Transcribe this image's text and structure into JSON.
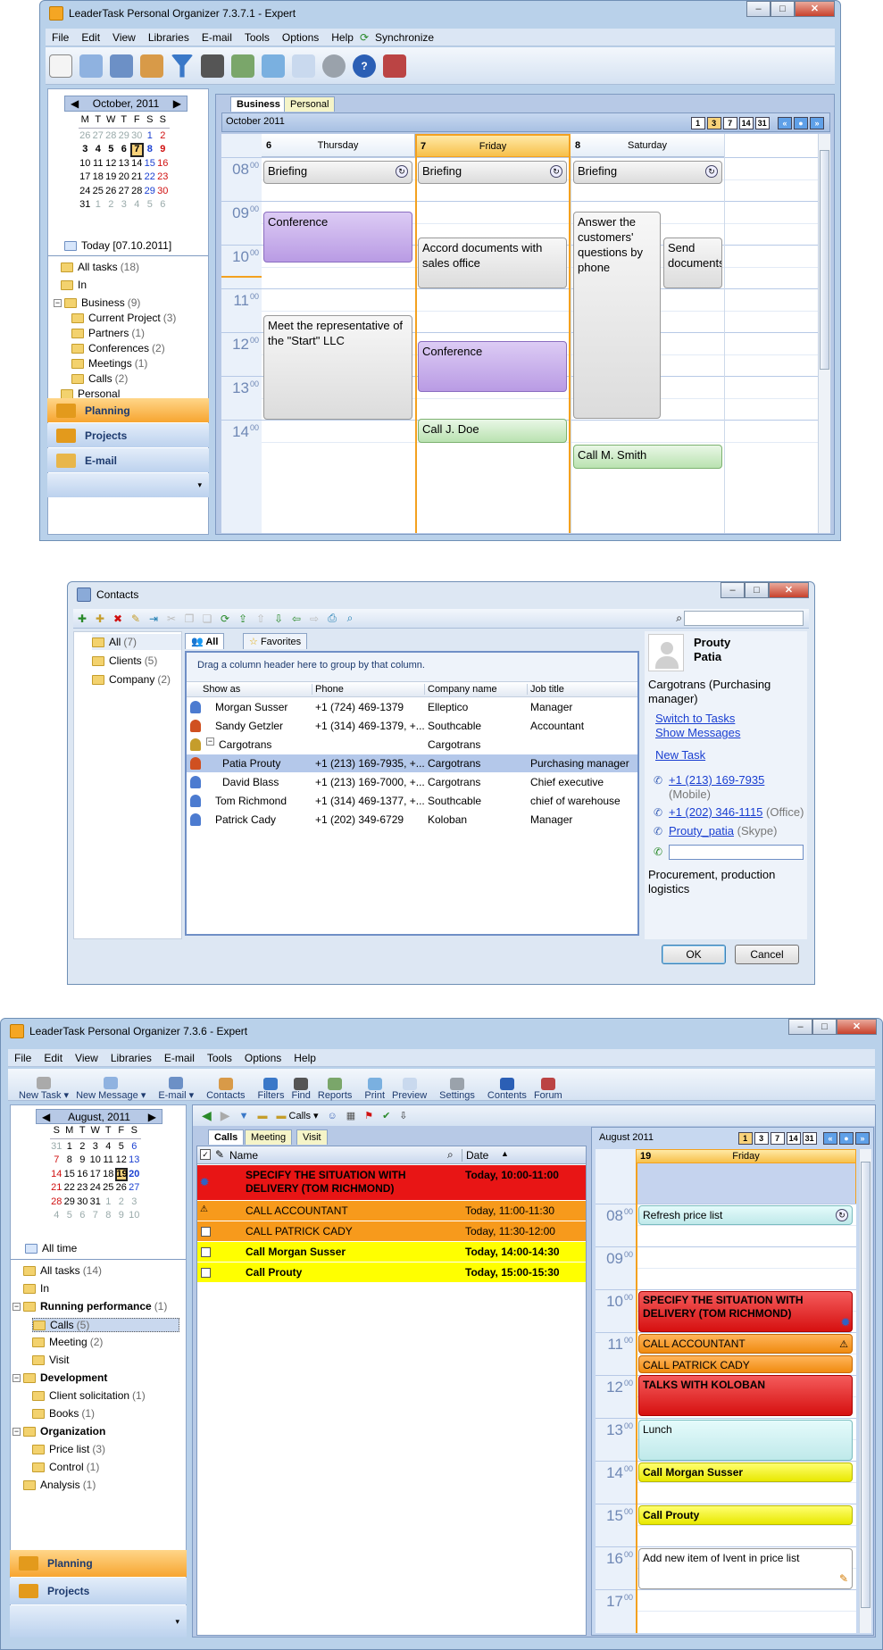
{
  "win1": {
    "title": "LeaderTask Personal Organizer 7.3.7.1 - Expert",
    "menu": [
      "File",
      "Edit",
      "View",
      "Libraries",
      "E-mail",
      "Tools",
      "Options",
      "Help",
      "Synchronize"
    ],
    "mini_cal": {
      "month": "October, 2011",
      "weekdays": [
        "M",
        "T",
        "W",
        "T",
        "F",
        "S",
        "S"
      ],
      "weeks": [
        [
          "26",
          "27",
          "28",
          "29",
          "30",
          "1",
          "2"
        ],
        [
          "3",
          "4",
          "5",
          "6",
          "7",
          "8",
          "9"
        ],
        [
          "10",
          "11",
          "12",
          "13",
          "14",
          "15",
          "16"
        ],
        [
          "17",
          "18",
          "19",
          "20",
          "21",
          "22",
          "23"
        ],
        [
          "24",
          "25",
          "26",
          "27",
          "28",
          "29",
          "30"
        ],
        [
          "31",
          "1",
          "2",
          "3",
          "4",
          "5",
          "6"
        ]
      ],
      "today": "Today [07.10.2011]"
    },
    "tree": [
      {
        "label": "All tasks",
        "count": "(18)"
      },
      {
        "label": "In",
        "count": ""
      },
      {
        "label": "Business",
        "count": "(9)"
      },
      {
        "label": "Current Project",
        "count": "(3)"
      },
      {
        "label": "Partners",
        "count": "(1)"
      },
      {
        "label": "Conferences",
        "count": "(2)"
      },
      {
        "label": "Meetings",
        "count": "(1)"
      },
      {
        "label": "Calls",
        "count": "(2)"
      },
      {
        "label": "Personal",
        "count": ""
      }
    ],
    "nav": [
      "Planning",
      "Projects",
      "E-mail"
    ],
    "tabs": [
      "Business",
      "Personal"
    ],
    "period": "October 2011",
    "views": [
      "1",
      "3",
      "7",
      "14",
      "31"
    ],
    "days": [
      {
        "num": "6",
        "name": "Thursday"
      },
      {
        "num": "7",
        "name": "Friday"
      },
      {
        "num": "8",
        "name": "Saturday"
      }
    ],
    "hours": [
      "08",
      "09",
      "10",
      "11",
      "12",
      "13",
      "14"
    ],
    "minutes": "00",
    "events": {
      "briefing": "Briefing",
      "conference": "Conference",
      "meet": "Meet the representative of the \"Start\" LLC",
      "accord": "Accord documents with sales office",
      "conference2": "Conference",
      "call_doe": "Call J. Doe",
      "answer": "Answer the customers' questions by phone",
      "send": "Send documents",
      "call_smith": "Call M. Smith"
    }
  },
  "win2": {
    "title": "Contacts",
    "groups": [
      {
        "label": "All",
        "count": "(7)"
      },
      {
        "label": "Clients",
        "count": "(5)"
      },
      {
        "label": "Company",
        "count": "(2)"
      }
    ],
    "tabs": [
      "All",
      "Favorites"
    ],
    "group_hint": "Drag a column header here to group by that column.",
    "columns": [
      "Show as",
      "Phone",
      "Company name",
      "Job title"
    ],
    "rows": [
      {
        "name": "Morgan Susser",
        "phone": "+1 (724) 469-1379",
        "company": "Elleptico",
        "job": "Manager"
      },
      {
        "name": "Sandy Getzler",
        "phone": "+1 (314) 469-1379, +...",
        "company": "Southcable",
        "job": "Accountant"
      },
      {
        "name": "Cargotrans",
        "phone": "",
        "company": "Cargotrans",
        "job": ""
      },
      {
        "name": "Patia Prouty",
        "phone": "+1 (213) 169-7935, +...",
        "company": "Cargotrans",
        "job": "Purchasing manager"
      },
      {
        "name": "David Blass",
        "phone": "+1 (213) 169-7000, +...",
        "company": "Cargotrans",
        "job": "Chief executive"
      },
      {
        "name": "Tom Richmond",
        "phone": "+1 (314) 469-1377, +...",
        "company": "Southcable",
        "job": "chief of warehouse"
      },
      {
        "name": "Patrick Cady",
        "phone": "+1 (202) 349-6729",
        "company": "Koloban",
        "job": "Manager"
      }
    ],
    "detail": {
      "last": "Prouty",
      "first": "Patia",
      "company": "Cargotrans (Purchasing manager)",
      "switch": "Switch to Tasks",
      "show": "Show Messages",
      "new_task": "New Task",
      "phone1": "+1 (213) 169-7935",
      "phone1_type": "(Mobile)",
      "phone2": "+1 (202) 346-1115",
      "phone2_type": "(Office)",
      "skype": "Prouty_patia",
      "skype_type": "(Skype)",
      "note": "Procurement, production logistics"
    },
    "ok": "OK",
    "cancel": "Cancel"
  },
  "win3": {
    "title": "LeaderTask Personal Organizer 7.3.6 - Expert",
    "menu": [
      "File",
      "Edit",
      "View",
      "Libraries",
      "E-mail",
      "Tools",
      "Options",
      "Help"
    ],
    "toolbar": [
      "New Task",
      "New Message",
      "E-mail",
      "Contacts",
      "Filters",
      "Find",
      "Reports",
      "Print",
      "Preview",
      "Settings",
      "Contents",
      "Forum"
    ],
    "mini_cal": {
      "month": "August, 2011",
      "weekdays": [
        "S",
        "M",
        "T",
        "W",
        "T",
        "F",
        "S"
      ],
      "weeks": [
        [
          "31",
          "1",
          "2",
          "3",
          "4",
          "5",
          "6"
        ],
        [
          "7",
          "8",
          "9",
          "10",
          "11",
          "12",
          "13"
        ],
        [
          "14",
          "15",
          "16",
          "17",
          "18",
          "19",
          "20"
        ],
        [
          "21",
          "22",
          "23",
          "24",
          "25",
          "26",
          "27"
        ],
        [
          "28",
          "29",
          "30",
          "31",
          "1",
          "2",
          "3"
        ],
        [
          "4",
          "5",
          "6",
          "7",
          "8",
          "9",
          "10"
        ]
      ],
      "all_time": "All time"
    },
    "tree": [
      {
        "label": "All tasks",
        "count": "(14)"
      },
      {
        "label": "In",
        "count": ""
      },
      {
        "label": "Running performance",
        "count": "(1)"
      },
      {
        "label": "Calls",
        "count": "(5)"
      },
      {
        "label": "Meeting",
        "count": "(2)"
      },
      {
        "label": "Visit",
        "count": ""
      },
      {
        "label": "Development",
        "count": ""
      },
      {
        "label": "Client solicitation",
        "count": "(1)"
      },
      {
        "label": "Books",
        "count": "(1)"
      },
      {
        "label": "Organization",
        "count": ""
      },
      {
        "label": "Price list",
        "count": "(3)"
      },
      {
        "label": "Control",
        "count": "(1)"
      },
      {
        "label": "Analysis",
        "count": "(1)"
      }
    ],
    "nav": [
      "Planning",
      "Projects"
    ],
    "filterbar": {
      "calls": "Calls"
    },
    "tabs": [
      "Calls",
      "Meeting",
      "Visit"
    ],
    "columns": [
      "Name",
      "Date"
    ],
    "tasks": [
      {
        "name": "SPECIFY THE SITUATION WITH DELIVERY (TOM RICHMOND)",
        "date": "Today, 10:00-11:00",
        "color": "#e81515"
      },
      {
        "name": "CALL ACCOUNTANT",
        "date": "Today, 11:00-11:30",
        "color": "#f79a1c"
      },
      {
        "name": "CALL PATRICK CADY",
        "date": "Today, 11:30-12:00",
        "color": "#f79a1c"
      },
      {
        "name": "Call Morgan Susser",
        "date": "Today, 14:00-14:30",
        "color": "#ffff00"
      },
      {
        "name": "Call Prouty",
        "date": "Today, 15:00-15:30",
        "color": "#ffff00"
      }
    ],
    "period": "August 2011",
    "views": [
      "1",
      "3",
      "7",
      "14",
      "31"
    ],
    "day": {
      "num": "19",
      "name": "Friday"
    },
    "hours": [
      "08",
      "09",
      "10",
      "11",
      "12",
      "13",
      "14",
      "15",
      "16",
      "17"
    ],
    "minutes": "00",
    "events": {
      "refresh": "Refresh price list",
      "specify": "SPECIFY THE SITUATION WITH DELIVERY (TOM RICHMOND)",
      "accountant": "CALL ACCOUNTANT",
      "cady": "CALL PATRICK CADY",
      "koloban": "TALKS WITH KOLOBAN",
      "lunch": "Lunch",
      "susser": "Call Morgan Susser",
      "prouty": "Call Prouty",
      "additem": "Add new item of Ivent in price list"
    }
  }
}
